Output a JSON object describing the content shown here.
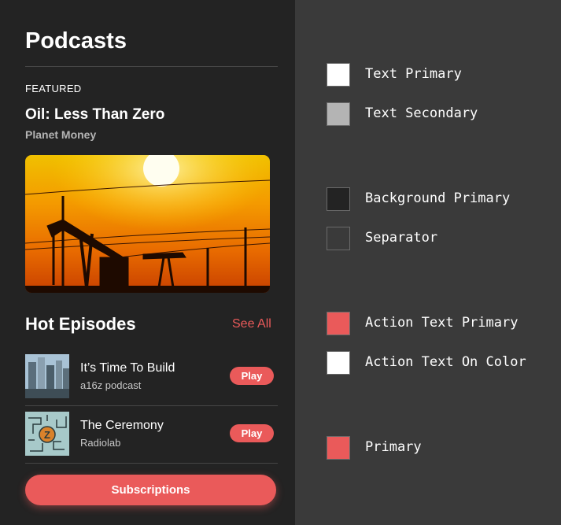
{
  "app": {
    "title": "Podcasts",
    "featured": {
      "label": "FEATURED",
      "title": "Oil: Less Than Zero",
      "podcast": "Planet Money"
    },
    "hot_episodes": {
      "title": "Hot Episodes",
      "see_all": "See All",
      "items": [
        {
          "title": "It’s Time To Build",
          "podcast": "a16z podcast",
          "action": "Play"
        },
        {
          "title": "The Ceremony",
          "podcast": "Radiolab",
          "action": "Play"
        }
      ]
    },
    "subscriptions_button": "Subscriptions"
  },
  "palette": [
    {
      "name": "Text Primary",
      "color": "#ffffff"
    },
    {
      "name": "Text Secondary",
      "color": "#b4b4b4"
    },
    {
      "name": "Background Primary",
      "color": "#232323"
    },
    {
      "name": "Separator",
      "color": "#3a3a3a"
    },
    {
      "name": "Action Text Primary",
      "color": "#ea5a5a"
    },
    {
      "name": "Action Text On Color",
      "color": "#ffffff"
    },
    {
      "name": "Primary",
      "color": "#ea5a5a"
    }
  ]
}
